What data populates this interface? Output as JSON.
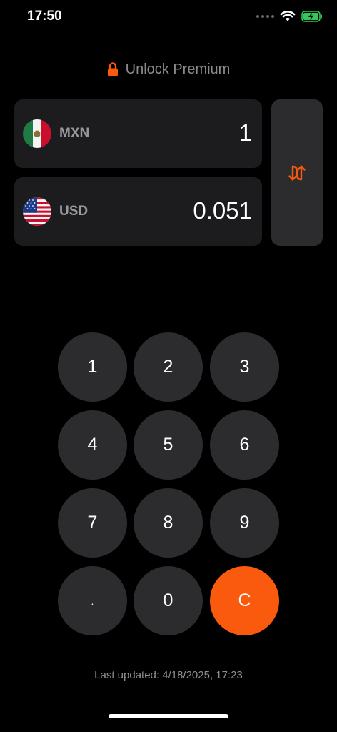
{
  "status_bar": {
    "time": "17:50"
  },
  "premium": {
    "label": "Unlock Premium"
  },
  "converter": {
    "from": {
      "code": "MXN",
      "amount": "1"
    },
    "to": {
      "code": "USD",
      "amount": "0.051"
    }
  },
  "keypad": {
    "keys": [
      "1",
      "2",
      "3",
      "4",
      "5",
      "6",
      "7",
      "8",
      "9",
      ".",
      "0",
      "C"
    ]
  },
  "footer": {
    "last_updated": "Last updated: 4/18/2025, 17:23"
  },
  "colors": {
    "accent": "#fa5a0e",
    "background": "#000000",
    "card": "#1c1c1e",
    "key": "#2c2c2e"
  },
  "icons": {
    "lock": "lock-icon",
    "swap": "swap-arrows-icon",
    "wifi": "wifi-icon",
    "battery": "battery-charging-icon"
  }
}
